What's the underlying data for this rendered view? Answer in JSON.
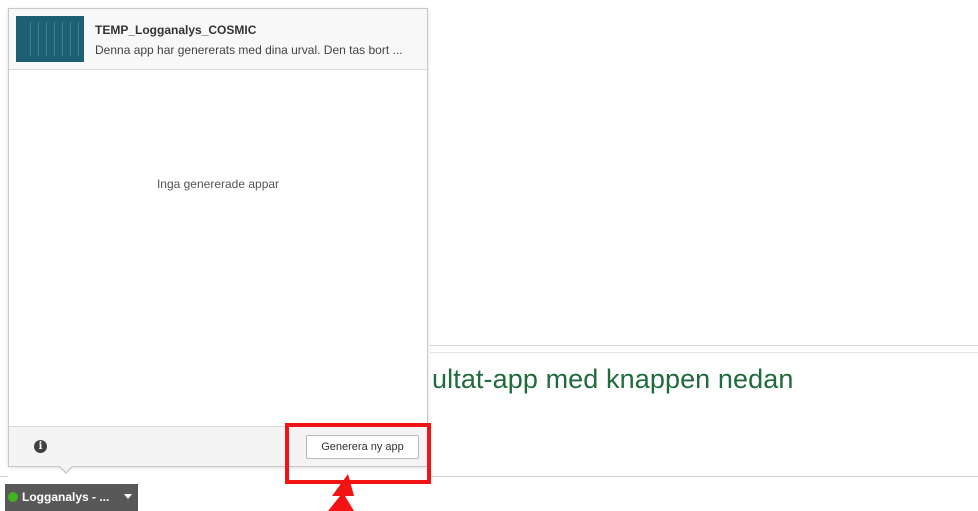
{
  "background": {
    "heading": "ultat-app med knappen nedan",
    "heading_color": "#1f6b3b"
  },
  "popover": {
    "app_item": {
      "title": "TEMP_Logganalys_COSMIC",
      "description": "Denna app har genererats med dina urval. Den tas bort ..."
    },
    "empty_message": "Inga genererade appar",
    "footer": {
      "info_icon": "info-icon",
      "info_glyph": "i",
      "generate_button_label": "Generera ny app"
    }
  },
  "app_pill": {
    "label": "Logganalys - ...",
    "status_color": "#3fb21e",
    "caret_icon": "caret-down-icon"
  },
  "annotations": {
    "highlight_color": "#f21414",
    "arrow_icon": "red-arrow-icon"
  }
}
